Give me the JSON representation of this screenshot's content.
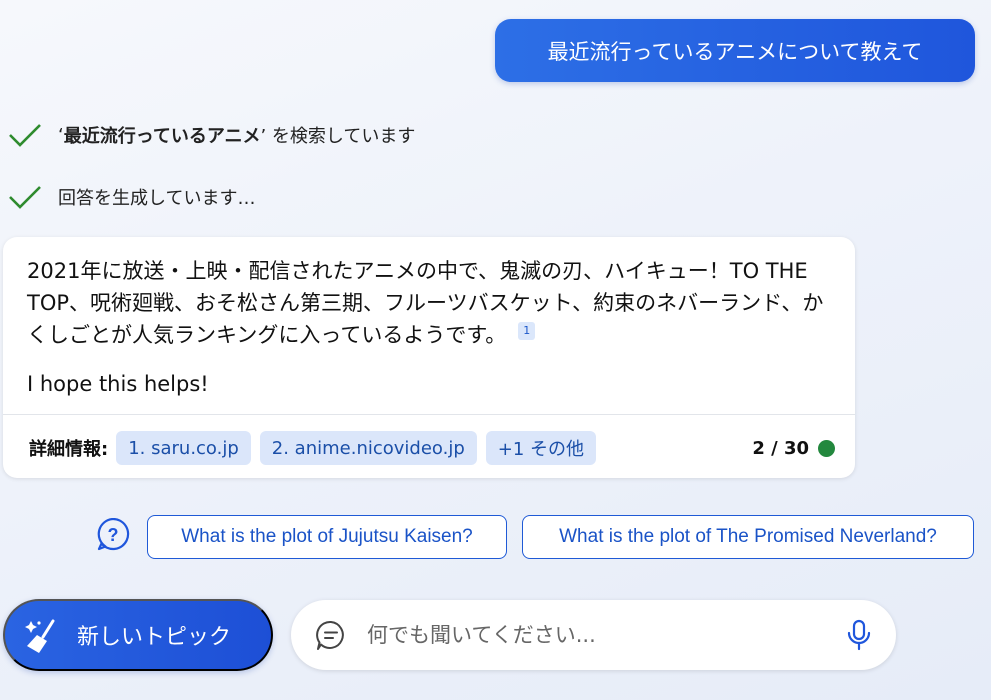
{
  "user_message": "最近流行っているアニメについて教えて",
  "status": [
    {
      "prefix": "‘",
      "bold": "最近流行っているアニメ",
      "suffix": "’ を検索しています"
    },
    {
      "text": "回答を生成しています…"
    }
  ],
  "answer": {
    "body": "2021年に放送・上映・配信されたアニメの中で、鬼滅の刃、ハイキュー！TO THE TOP、呪術廻戦、おそ松さん第三期、フルーツバスケット、約束のネバーランド、かくしごとが人気ランキングに入っているようです。",
    "citation": "1",
    "closing": "I hope this helps!",
    "details_label": "詳細情報:",
    "links": [
      "1. saru.co.jp",
      "2. anime.nicovideo.jp",
      "+1 その他"
    ],
    "counter": "2 / 30"
  },
  "suggestions": [
    "What is the plot of Jujutsu Kaisen?",
    "What is the plot of The Promised Neverland?"
  ],
  "new_topic_label": "新しいトピック",
  "input_placeholder": "何でも聞いてください...",
  "colors": {
    "accent": "#1f56dc",
    "check": "#2e8b2e",
    "status_dot": "#23883e"
  }
}
